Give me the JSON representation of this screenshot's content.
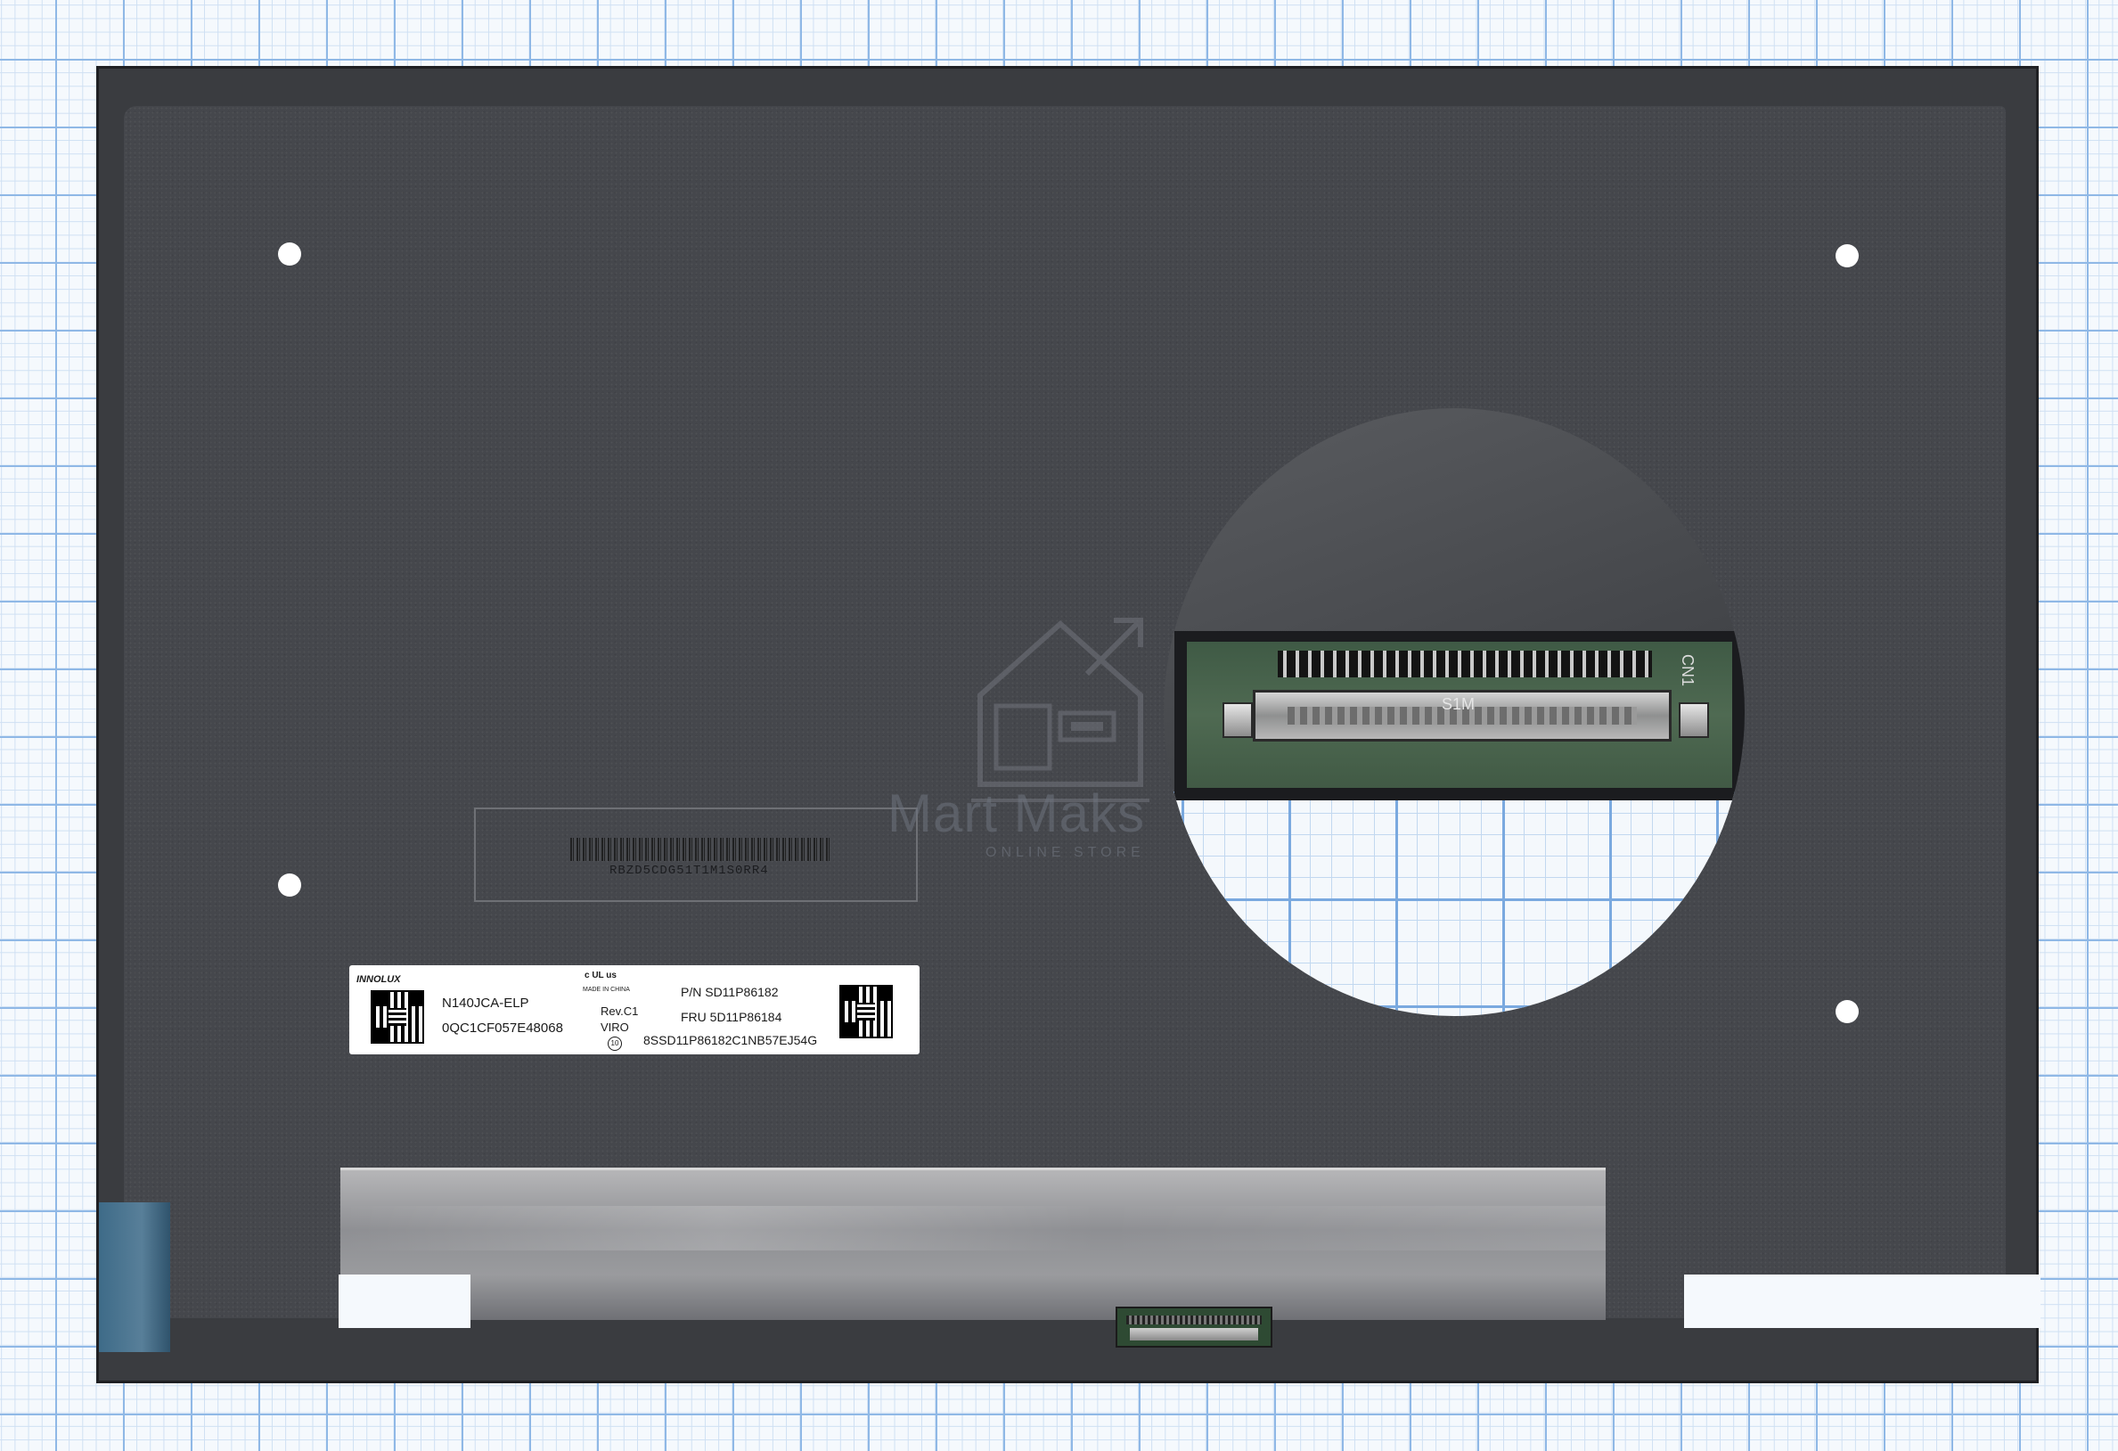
{
  "photo": {
    "subject": "laptop-lcd-panel-rear-view",
    "background": "graph-paper"
  },
  "label": {
    "brand": "INNOLUX",
    "model": "N140JCA-ELP",
    "serial": "0QC1CF057E48068",
    "cert_mark": "c UL us",
    "made_in": "MADE IN CHINA",
    "rev": "Rev.C1",
    "viro": "VIRO",
    "pn": "P/N SD11P86182",
    "fru": "FRU 5D11P86184",
    "code": "8SSD11P86182C1NB57EJ54G",
    "circle_mark": "10"
  },
  "barcode": {
    "text": "RBZD5CDG51T1M1S0RR4"
  },
  "zoom": {
    "silk_label": "S1M",
    "side_label": "CN1"
  },
  "watermark": {
    "brand": "Mart Maks",
    "tagline": "ONLINE STORE"
  },
  "colors": {
    "panel": "#45474c",
    "grid_major": "#8fb8e6",
    "pcb": "#4f6a52"
  }
}
